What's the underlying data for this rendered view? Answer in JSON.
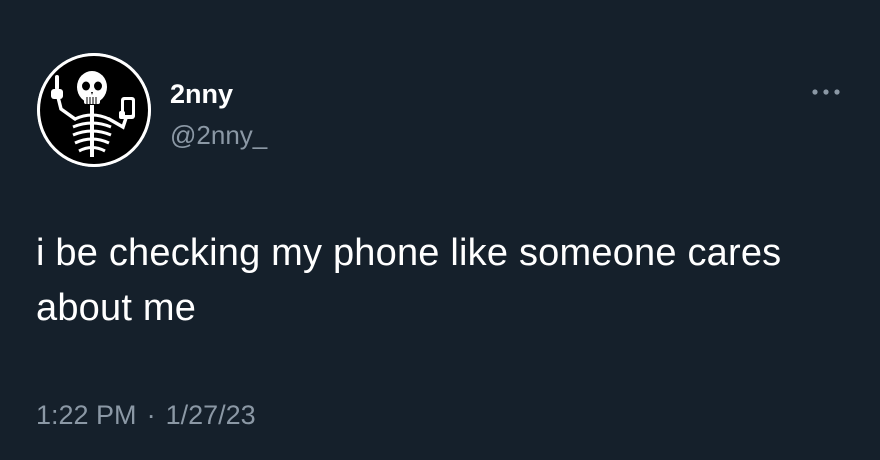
{
  "author": {
    "display_name": "2nny",
    "handle": "@2nny_",
    "avatar_icon": "skeleton-avatar-icon"
  },
  "tweet": {
    "text": "i be checking my phone like someone cares about me",
    "time": "1:22 PM",
    "separator": "·",
    "date": "1/27/23"
  },
  "menu": {
    "icon": "more-options-icon"
  },
  "colors": {
    "background": "#15202b",
    "primary_text": "#ffffff",
    "secondary_text": "#8b98a5"
  }
}
